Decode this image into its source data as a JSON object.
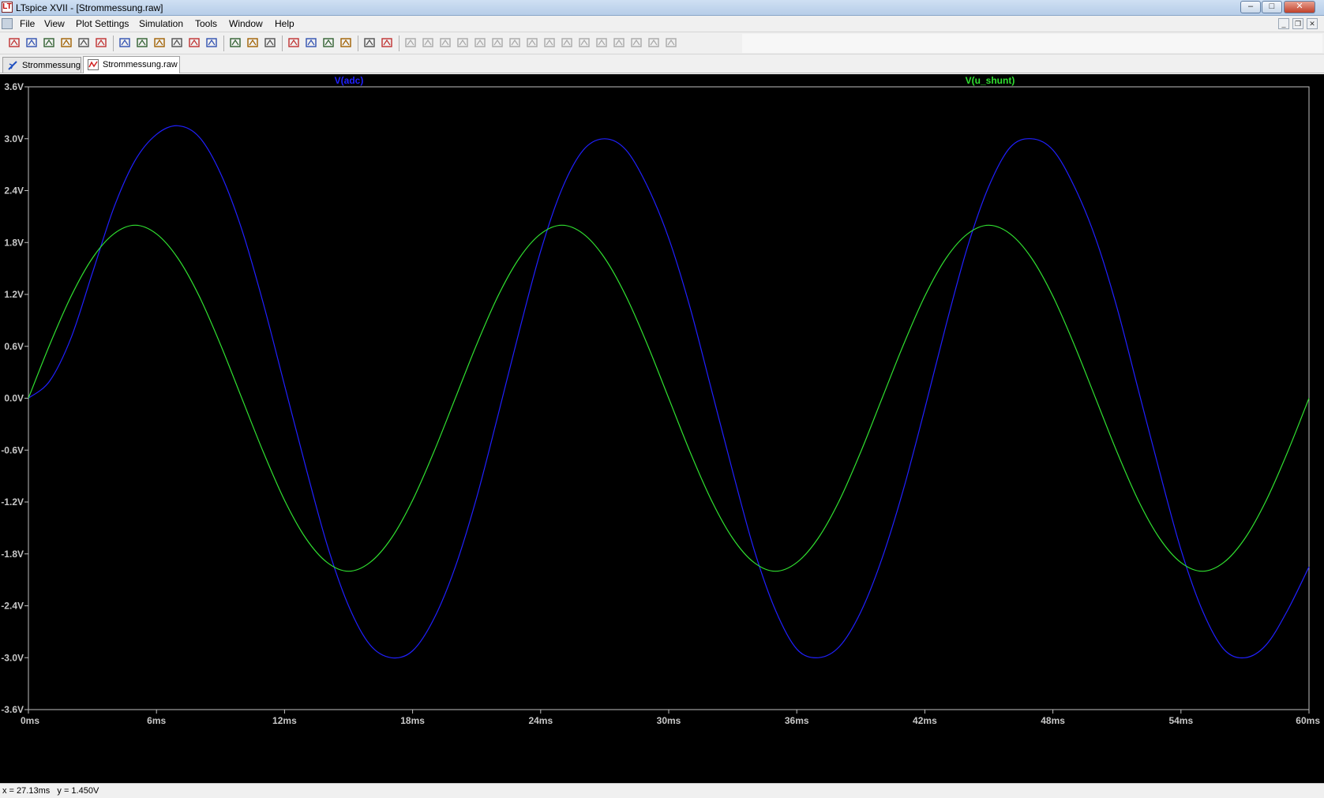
{
  "window": {
    "title": "LTspice XVII - [Strommessung.raw]"
  },
  "menu": {
    "items": [
      "File",
      "View",
      "Plot Settings",
      "Simulation",
      "Tools",
      "Window",
      "Help"
    ]
  },
  "toolbar": {
    "icons": [
      "new-schematic-icon",
      "open-icon",
      "save-icon",
      "control-panel-icon",
      "run-icon",
      "halt-icon",
      "zoom-in-icon",
      "zoom-out-icon",
      "zoom-area-icon",
      "zoom-cancel-icon",
      "autorange-icon",
      "grid-icon",
      "tile-horizontal-icon",
      "cascade-icon",
      "tile-vertical-icon",
      "cut-icon",
      "copy-icon",
      "paste-icon",
      "find-icon",
      "print-preview-icon",
      "print-icon",
      "wire-icon",
      "ground-icon",
      "label-icon",
      "resistor-icon",
      "capacitor-icon",
      "inductor-icon",
      "diode-icon",
      "component-icon",
      "move-icon",
      "drag-icon",
      "undo-icon",
      "redo-icon",
      "rotate-icon",
      "mirror-icon",
      "text-icon",
      "spice-directive-icon"
    ]
  },
  "tabs": [
    {
      "label": "Strommessung",
      "icon": "schematic-icon",
      "active": false
    },
    {
      "label": "Strommessung.raw",
      "icon": "waveform-icon",
      "active": true
    }
  ],
  "status": {
    "text": "x = 27.13ms   y = 1.450V"
  },
  "chart_data": {
    "type": "line",
    "background": "#000000",
    "xlim": [
      0,
      60
    ],
    "ylim": [
      -3.6,
      3.6
    ],
    "x_ticks": [
      "0ms",
      "6ms",
      "12ms",
      "18ms",
      "24ms",
      "30ms",
      "36ms",
      "42ms",
      "48ms",
      "54ms",
      "60ms"
    ],
    "y_ticks": [
      "3.6V",
      "3.0V",
      "2.4V",
      "1.8V",
      "1.2V",
      "0.6V",
      "0.0V",
      "-0.6V",
      "-1.2V",
      "-1.8V",
      "-2.4V",
      "-3.0V",
      "-3.6V"
    ],
    "series": [
      {
        "name": "V(adc)",
        "color": "#2020ff",
        "x": [
          0,
          1,
          2,
          3,
          4,
          5,
          6,
          7,
          8,
          9,
          10,
          11,
          12,
          13,
          14,
          15,
          16,
          17,
          18,
          19,
          20,
          21,
          22,
          23,
          24,
          25,
          26,
          27,
          28,
          29,
          30,
          31,
          32,
          33,
          34,
          35,
          36,
          37,
          38,
          39,
          40,
          41,
          42,
          43,
          44,
          45,
          46,
          47,
          48,
          49,
          50,
          51,
          52,
          53,
          54,
          55,
          56,
          57,
          58,
          59,
          60
        ],
        "values": [
          0.0,
          0.2,
          0.7,
          1.45,
          2.2,
          2.75,
          3.05,
          3.15,
          3.02,
          2.6,
          1.95,
          1.1,
          0.15,
          -0.8,
          -1.7,
          -2.4,
          -2.85,
          -3.0,
          -2.92,
          -2.55,
          -1.95,
          -1.15,
          -0.2,
          0.78,
          1.7,
          2.42,
          2.87,
          3.0,
          2.87,
          2.45,
          1.85,
          1.05,
          0.1,
          -0.85,
          -1.75,
          -2.45,
          -2.9,
          -3.0,
          -2.87,
          -2.47,
          -1.85,
          -1.05,
          -0.12,
          0.85,
          1.75,
          2.45,
          2.9,
          3.0,
          2.87,
          2.45,
          1.85,
          1.05,
          0.1,
          -0.85,
          -1.75,
          -2.45,
          -2.9,
          -3.0,
          -2.85,
          -2.45,
          -1.95
        ]
      },
      {
        "name": "V(u_shunt)",
        "color": "#30e030",
        "x": [
          0,
          1,
          2,
          3,
          4,
          5,
          6,
          7,
          8,
          9,
          10,
          11,
          12,
          13,
          14,
          15,
          16,
          17,
          18,
          19,
          20,
          21,
          22,
          23,
          24,
          25,
          26,
          27,
          28,
          29,
          30,
          31,
          32,
          33,
          34,
          35,
          36,
          37,
          38,
          39,
          40,
          41,
          42,
          43,
          44,
          45,
          46,
          47,
          48,
          49,
          50,
          51,
          52,
          53,
          54,
          55,
          56,
          57,
          58,
          59,
          60
        ],
        "values": [
          0.0,
          0.62,
          1.18,
          1.62,
          1.9,
          2.0,
          1.9,
          1.62,
          1.18,
          0.62,
          0.0,
          -0.62,
          -1.18,
          -1.62,
          -1.9,
          -2.0,
          -1.9,
          -1.62,
          -1.18,
          -0.62,
          0.0,
          0.62,
          1.18,
          1.62,
          1.9,
          2.0,
          1.9,
          1.62,
          1.18,
          0.62,
          0.0,
          -0.62,
          -1.18,
          -1.62,
          -1.9,
          -2.0,
          -1.9,
          -1.62,
          -1.18,
          -0.62,
          0.0,
          0.62,
          1.18,
          1.62,
          1.9,
          2.0,
          1.9,
          1.62,
          1.18,
          0.62,
          0.0,
          -0.62,
          -1.18,
          -1.62,
          -1.9,
          -2.0,
          -1.9,
          -1.62,
          -1.18,
          -0.62,
          0.0
        ]
      }
    ]
  }
}
